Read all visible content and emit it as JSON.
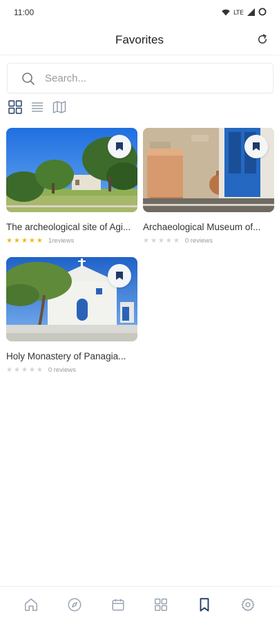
{
  "status_bar": {
    "time": "11:00",
    "network": "LTE",
    "icons": [
      "wifi-icon",
      "signal-icon",
      "circle-icon"
    ]
  },
  "header": {
    "title": "Favorites",
    "refresh_icon": "refresh-icon"
  },
  "search": {
    "placeholder": "Search..."
  },
  "view_modes": [
    "grid-view-icon",
    "list-view-icon",
    "map-view-icon"
  ],
  "colors": {
    "accent": "#1f3864",
    "star_filled": "#f2b81a",
    "star_empty": "#d4d4d4",
    "nav_icon": "#9aa3b0",
    "nav_active": "#1f3864"
  },
  "favorites": [
    {
      "title": "The archeological site of Agi...",
      "rating": 5,
      "reviews": "1reviews",
      "image": "park-scene"
    },
    {
      "title": "Archaeological Museum of...",
      "rating": 0,
      "reviews": "0 reviews",
      "image": "blue-door-amphora"
    },
    {
      "title": "Holy Monastery of Panagia...",
      "rating": 0,
      "reviews": "0 reviews",
      "image": "white-chapel"
    }
  ],
  "bottom_nav": {
    "items": [
      "home-icon",
      "compass-icon",
      "calendar-icon",
      "apps-grid-icon",
      "bookmark-icon",
      "settings-icon"
    ],
    "active": "bookmark-icon"
  }
}
